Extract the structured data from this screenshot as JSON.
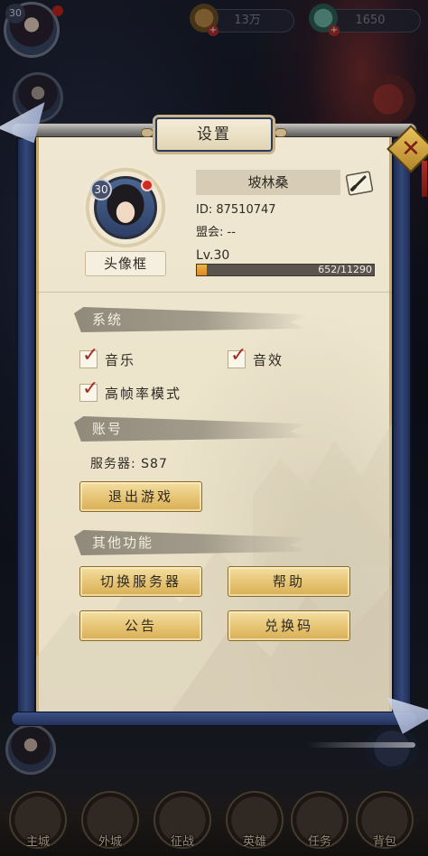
{
  "top_bar": {
    "gold_amount": "13万",
    "jade_amount": "1650",
    "player_level": "30"
  },
  "dialog": {
    "title": "设置",
    "close_icon": "close-x-icon",
    "profile": {
      "level_badge": "30",
      "avatar_frame_button": "头像框",
      "name": "坡林桑",
      "id_line": "ID: 87510747",
      "alliance_line": "盟会: --",
      "level_text": "Lv.30",
      "exp_text": "652/11290",
      "exp_current": 652,
      "exp_max": 11290
    },
    "system_section": {
      "header": "系统",
      "options": [
        {
          "label": "音乐",
          "checked": true
        },
        {
          "label": "音效",
          "checked": true
        },
        {
          "label": "高帧率模式",
          "checked": true
        }
      ]
    },
    "account_section": {
      "header": "账号",
      "server_label": "服务器: S87",
      "logout_button": "退出游戏"
    },
    "other_section": {
      "header": "其他功能",
      "buttons": {
        "switch_server": "切换服务器",
        "help": "帮助",
        "announcement": "公告",
        "redeem": "兑换码"
      }
    }
  },
  "bottom_nav": {
    "items": [
      "主城",
      "外城",
      "征战",
      "英雄",
      "任务",
      "背包"
    ]
  },
  "colors": {
    "paper": "#ede4cc",
    "scroll_blue": "#2a3a68",
    "gold_button": "#e7c677",
    "check_red": "#a52a22",
    "exp_fill": "#e09a2c"
  }
}
